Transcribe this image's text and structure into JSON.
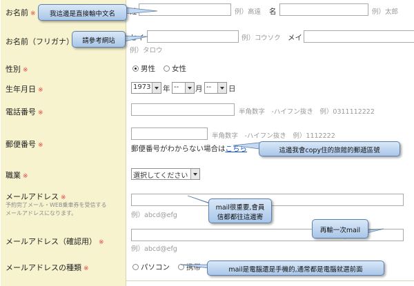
{
  "required_mark": "※",
  "rows": {
    "name": {
      "label": "お名前",
      "sei_label": "姓",
      "sei_example": "例）高遠",
      "mei_label": "名",
      "mei_example": "例）太郎"
    },
    "furigana": {
      "label": "お名前（フリガナ）",
      "sei_label": "セイ",
      "sei_example": "例）コウソク",
      "mei_label": "メイ",
      "mei_example": "例）タロウ"
    },
    "gender": {
      "label": "性別",
      "options": [
        "男性",
        "女性"
      ],
      "selected": "男性"
    },
    "birthday": {
      "label": "生年月日",
      "year": "1973",
      "year_unit": "年",
      "month": "--",
      "month_unit": "月",
      "day": "--",
      "day_unit": "日"
    },
    "phone": {
      "label": "電話番号",
      "hint": "半角数字　-ハイフン抜き　例）0311112222"
    },
    "postal": {
      "label": "郵便番号",
      "hint": "半角数字　-ハイフン抜き　例）1112222",
      "unknown_text": "郵便番号がわからない場合は",
      "unknown_link": "こちら"
    },
    "job": {
      "label": "職業",
      "select_value": "選択してください"
    },
    "email": {
      "label": "メールアドレス",
      "sub1": "予約完了メール・WEB乗車券を受信する",
      "sub2": "メールアドレスになります。",
      "example": "例）abcd@efg"
    },
    "email_confirm": {
      "label": "メールアドレス（確認用）",
      "example": "例）abcd@efg"
    },
    "email_type": {
      "label": "メールアドレスの種類",
      "options": [
        "パソコン",
        "携帯"
      ]
    }
  },
  "callouts": {
    "name": "我這邊是直接輸中文名",
    "furigana": "請參考網站",
    "postal": "這邊我會copy住的旅館的郵遞區號",
    "email": [
      "mail很重要,會員",
      "信都都往這邊寄"
    ],
    "email_confirm": "再輸一次mail",
    "email_type": "mail是電腦還是手機的,通常都是電腦就選前面"
  },
  "colors": {
    "label_bg": "#f7f3cf",
    "required": "#e23c3c",
    "link": "#1a55c8",
    "callout_bg": "#b9d3f0"
  }
}
